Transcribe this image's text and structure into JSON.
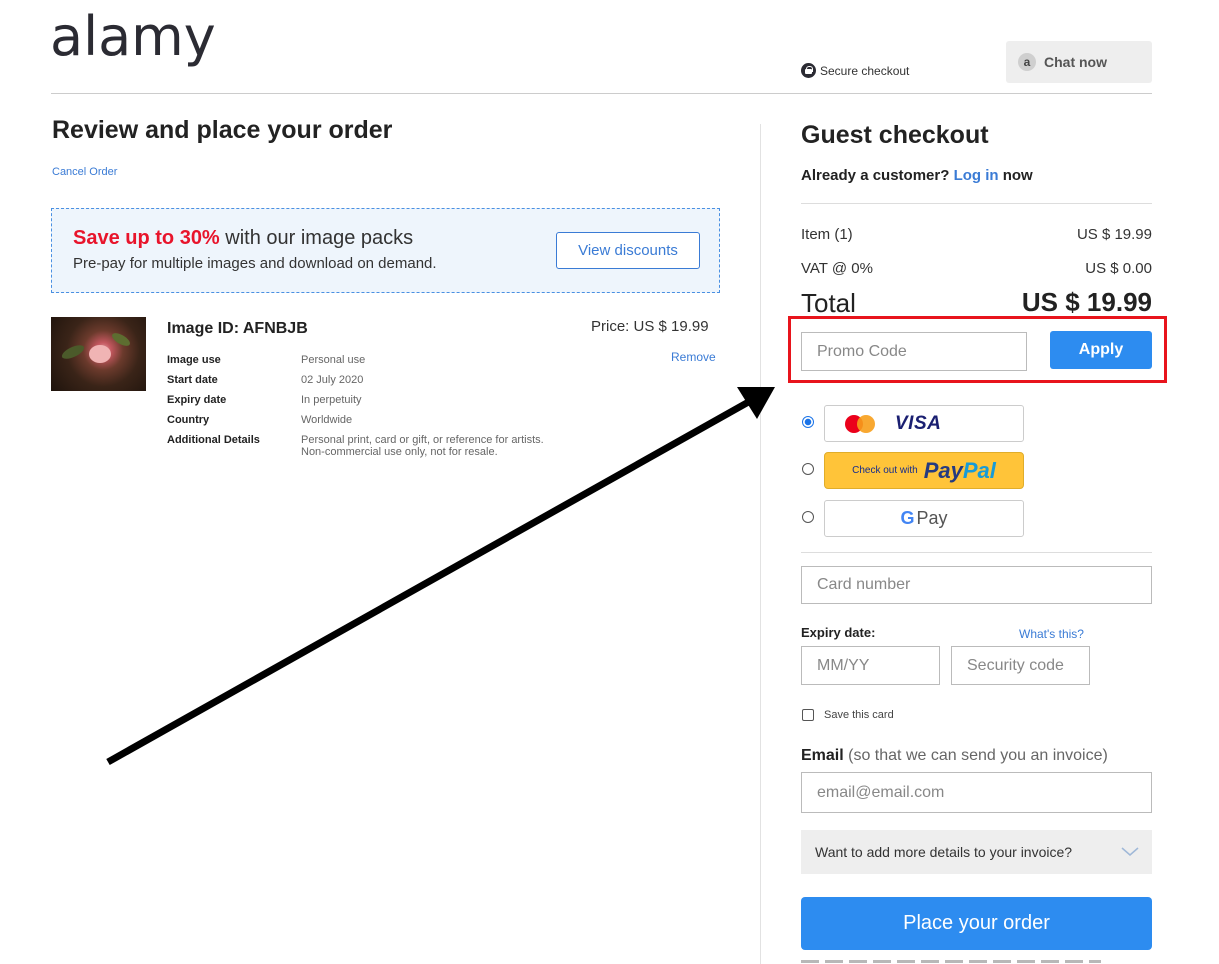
{
  "header": {
    "logo": "alamy",
    "secure_checkout": "Secure checkout",
    "chat_icon_letter": "a",
    "chat_label": "Chat now"
  },
  "review": {
    "title": "Review and place your order",
    "cancel_label": "Cancel Order",
    "promo": {
      "highlight": "Save up to 30%",
      "headline_rest": " with our image packs",
      "subtext": "Pre-pay for multiple images and download on demand.",
      "button_label": "View discounts"
    },
    "item": {
      "image_id": "Image ID: AFNBJB",
      "price": "Price: US $ 19.99",
      "remove_label": "Remove",
      "details": [
        {
          "label": "Image use",
          "value": "Personal use"
        },
        {
          "label": "Start date",
          "value": "02 July 2020"
        },
        {
          "label": "Expiry date",
          "value": "In perpetuity"
        },
        {
          "label": "Country",
          "value": "Worldwide"
        },
        {
          "label": "Additional Details",
          "value": "Personal print, card or gift, or reference for artists. Non-commercial use only, not for resale."
        }
      ]
    }
  },
  "checkout": {
    "title": "Guest checkout",
    "already_text": "Already a customer?",
    "login_label": "Log in",
    "now_text": "now",
    "summary": {
      "item_label": "Item (1)",
      "item_value": "US $ 19.99",
      "vat_label": "VAT @ 0%",
      "vat_value": "US $ 0.00",
      "total_label": "Total",
      "total_value": "US $ 19.99"
    },
    "promo_placeholder": "Promo Code",
    "apply_label": "Apply",
    "payment": {
      "visa_label": "VISA",
      "paypal_prefix": "Check out with",
      "paypal_pay": "Pay",
      "paypal_pal": "Pal",
      "gpay_g": "G",
      "gpay_label": "Pay",
      "selected": "card"
    },
    "card_number_placeholder": "Card number",
    "expiry_label": "Expiry date:",
    "whats_this": "What's this?",
    "mmyy_placeholder": "MM/YY",
    "security_placeholder": "Security code",
    "save_card_label": "Save this card",
    "email_label_bold": "Email",
    "email_label_rest": " (so that we can send you an invoice)",
    "email_placeholder": "email@email.com",
    "more_details_label": "Want to add more details to your invoice?",
    "place_order_label": "Place your order"
  },
  "colors": {
    "accent": "#2d8cf0",
    "link": "#3a7bd5",
    "highlight_border": "#e8141c",
    "promo_red": "#e8142b"
  }
}
